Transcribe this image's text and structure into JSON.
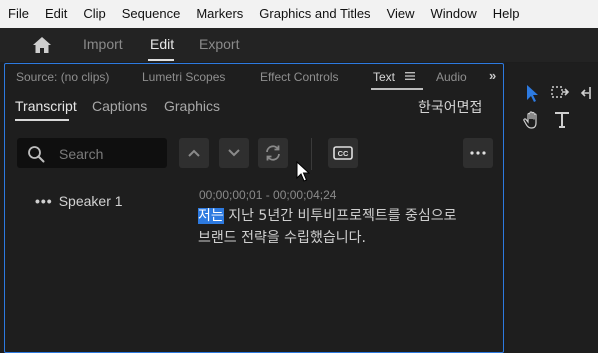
{
  "menu": [
    "File",
    "Edit",
    "Clip",
    "Sequence",
    "Markers",
    "Graphics and Titles",
    "View",
    "Window",
    "Help"
  ],
  "workspace": {
    "tabs": [
      "Import",
      "Edit",
      "Export"
    ],
    "active": "Edit"
  },
  "panel_tabs": {
    "source": "Source: (no clips)",
    "lumetri": "Lumetri Scopes",
    "effect_controls": "Effect Controls",
    "text": "Text",
    "audio": "Audio",
    "overflow": "»"
  },
  "sub_tabs": {
    "transcript": "Transcript",
    "captions": "Captions",
    "graphics": "Graphics",
    "language": "한국어면접"
  },
  "search": {
    "placeholder": "Search",
    "value": ""
  },
  "transcript": {
    "speaker_label": "Speaker 1",
    "speaker_menu": "•••",
    "timecode": "00;00;00;01 - 00;00;04;24",
    "highlighted_word": "저는",
    "line1_rest": " 지난 5년간 비투비프로젝트를 중심으로",
    "line2": "브랜드 전략을 수립했습니다."
  },
  "colors": {
    "accent": "#2d7ae0",
    "panel_bg": "#1e1e1e",
    "menubar_bg": "#f2f2f2"
  },
  "icons": [
    "home-icon",
    "search-icon",
    "chevron-up-icon",
    "chevron-down-icon",
    "refresh-icon",
    "closed-captions-icon",
    "more-icon",
    "selection-tool-icon",
    "track-select-icon",
    "hand-tool-icon",
    "type-tool-icon"
  ]
}
